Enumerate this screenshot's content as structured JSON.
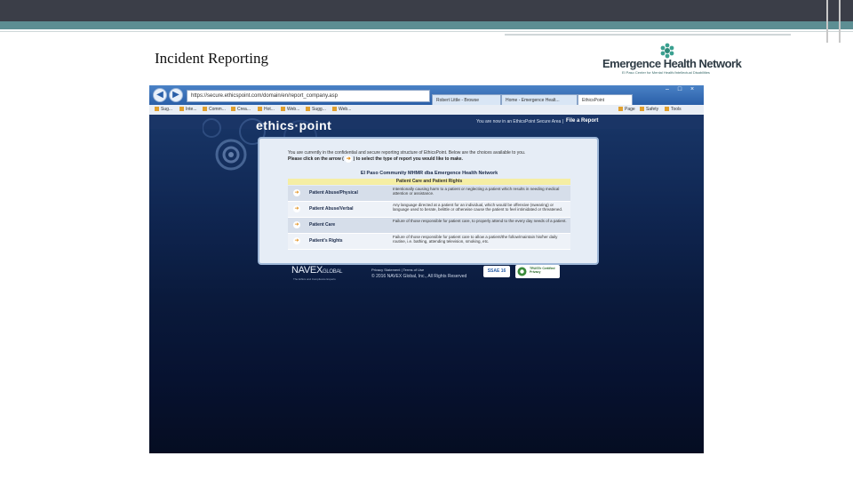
{
  "slide": {
    "title": "Incident Reporting",
    "logo": {
      "name": "Emergence Health Network",
      "subtitle": "El Paso Center for Mental Health/Intellectual Disabilities"
    }
  },
  "browser": {
    "url": "https://secure.ethicspoint.com/domain/en/report_company.asp",
    "tabs": [
      {
        "label": "Robert Little - Browse"
      },
      {
        "label": "Home - Emergence Healt..."
      },
      {
        "label": "EthicsPoint",
        "active": true
      }
    ],
    "favorites": [
      "Sug...",
      "Inte...",
      "Comm...",
      "Crea...",
      "Hot...",
      "Web...",
      "Sugg...",
      "Web..."
    ],
    "commands": [
      "Page",
      "Safety",
      "Tools"
    ]
  },
  "site": {
    "brand": "ethics·point",
    "secure_area_text": "You are now in an EthicsPoint Secure Area |",
    "file_report": "File a Report",
    "intro_line1": "You are currently in the confidential and secure reporting structure of EthicsPoint. Below are the choices available to you.",
    "intro_line2_a": "Please click on the arrow (",
    "intro_line2_b": ") to select the type of report you would like to make.",
    "organization": "El Paso Community MHMR dba Emergence Health Network",
    "category_header": "Patient Care and Patient Rights",
    "rows": [
      {
        "label": "Patient Abuse/Physical",
        "description": "Intentionally causing harm to a patient or neglecting a patient which results in needing medical attention or assistance."
      },
      {
        "label": "Patient Abuse/Verbal",
        "description": "Any language directed at a patient for an individual, which would be offensive (swearing) or language used to berate, belittle or otherwise cause the patient to feel intimidated or threatened."
      },
      {
        "label": "Patient Care",
        "description": "Failure of those responsible for patient care, to properly attend to the every day needs of a patient."
      },
      {
        "label": "Patient's Rights",
        "description": "Failure of those responsible for patient care to allow a patient/the follow/maintain his/her daily routine, i.e. bathing, attending television, smoking, etc."
      }
    ],
    "footer": {
      "navex": "NAVEX",
      "navex_global": "GLOBAL",
      "navex_tagline": "The Ethics and Compliance Experts",
      "links": "Privacy Statement   |   Terms of Use",
      "copyright": "© 2016 NAVEX Global, Inc., All Rights Reserved",
      "ssae": "SSAE 16",
      "trust_badge": "TRUSTe Certified Privacy"
    }
  }
}
